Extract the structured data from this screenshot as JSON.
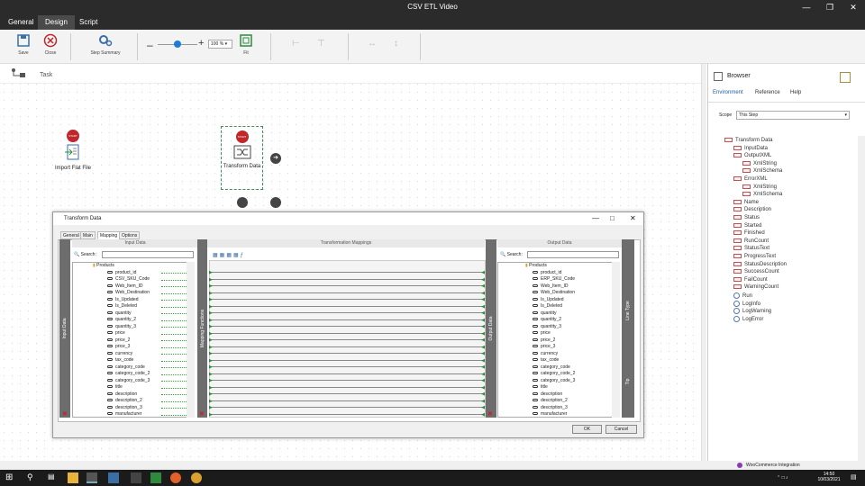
{
  "window": {
    "title": "CSV ETL Video"
  },
  "menu": {
    "tabs": [
      "General",
      "Design",
      "Script"
    ],
    "active": "Design"
  },
  "toolbar": {
    "save": "Save",
    "close": "Close",
    "step_summary": "Step Summary",
    "zoom": "100 %",
    "fit": "Fit"
  },
  "canvas": {
    "task_label": "Task",
    "nodes": {
      "import": "Import Flat File",
      "transform": "Transform Data",
      "start": "START"
    }
  },
  "dialog": {
    "title": "Transform Data",
    "tabs": [
      "General",
      "Main",
      "Mapping",
      "Options"
    ],
    "active_tab": "Mapping",
    "input_header": "Input Data",
    "mapping_header": "Transformation Mappings",
    "output_header": "Output Data",
    "search_label": "Search:",
    "input_bar": "Input Data",
    "mapping_bar": "Mapping Functions",
    "output_bar": "Output Data",
    "root": "Products",
    "input_fields": [
      "product_id",
      "CSV_SKU_Code",
      "Web_Item_ID",
      "Web_Destination",
      "Is_Updated",
      "Is_Deleted",
      "quantity",
      "quantity_2",
      "quantity_3",
      "price",
      "price_2",
      "price_3",
      "currency",
      "tax_code",
      "category_code",
      "category_code_2",
      "category_code_3",
      "title",
      "description",
      "description_2",
      "description_3",
      "manufacturer"
    ],
    "output_fields": [
      "product_id",
      "ERP_SKU_Code",
      "Web_Item_ID",
      "Web_Destination",
      "Is_Updated",
      "Is_Deleted",
      "quantity",
      "quantity_2",
      "quantity_3",
      "price",
      "price_2",
      "price_3",
      "currency",
      "tax_code",
      "category_code",
      "category_code_2",
      "category_code_3",
      "title",
      "description",
      "description_2",
      "description_3",
      "manufacturer"
    ],
    "side_bar": "Line Type",
    "side_bar2": "Tip",
    "ok": "OK",
    "cancel": "Cancel"
  },
  "browser": {
    "title": "Browser",
    "tabs": [
      "Environment",
      "Reference",
      "Help"
    ],
    "active_tab": "Environment",
    "scope_label": "Scope",
    "scope_value": "This Step",
    "tree": [
      {
        "label": "Transform Data",
        "level": 0,
        "kind": "node"
      },
      {
        "label": "InputData",
        "level": 1,
        "kind": "var"
      },
      {
        "label": "OutputXML",
        "level": 1,
        "kind": "var"
      },
      {
        "label": "XmlString",
        "level": 2,
        "kind": "var"
      },
      {
        "label": "XmlSchema",
        "level": 2,
        "kind": "var"
      },
      {
        "label": "ErrorXML",
        "level": 1,
        "kind": "var"
      },
      {
        "label": "XmlString",
        "level": 2,
        "kind": "var"
      },
      {
        "label": "XmlSchema",
        "level": 2,
        "kind": "var"
      },
      {
        "label": "Name",
        "level": 1,
        "kind": "var"
      },
      {
        "label": "Description",
        "level": 1,
        "kind": "var"
      },
      {
        "label": "Status",
        "level": 1,
        "kind": "var"
      },
      {
        "label": "Started",
        "level": 1,
        "kind": "var"
      },
      {
        "label": "Finished",
        "level": 1,
        "kind": "var"
      },
      {
        "label": "RunCount",
        "level": 1,
        "kind": "var"
      },
      {
        "label": "StatusText",
        "level": 1,
        "kind": "var"
      },
      {
        "label": "ProgressText",
        "level": 1,
        "kind": "var"
      },
      {
        "label": "StatusDescription",
        "level": 1,
        "kind": "var"
      },
      {
        "label": "SuccessCount",
        "level": 1,
        "kind": "var"
      },
      {
        "label": "FailCount",
        "level": 1,
        "kind": "var"
      },
      {
        "label": "WarningCount",
        "level": 1,
        "kind": "var"
      },
      {
        "label": "Run",
        "level": 1,
        "kind": "func"
      },
      {
        "label": "LogInfo",
        "level": 1,
        "kind": "func"
      },
      {
        "label": "LogWarning",
        "level": 1,
        "kind": "func"
      },
      {
        "label": "LogError",
        "level": 1,
        "kind": "func"
      }
    ],
    "footer": "WooCommerce Integration"
  },
  "taskbar": {
    "time": "14:50",
    "date": "10/03/2021"
  }
}
